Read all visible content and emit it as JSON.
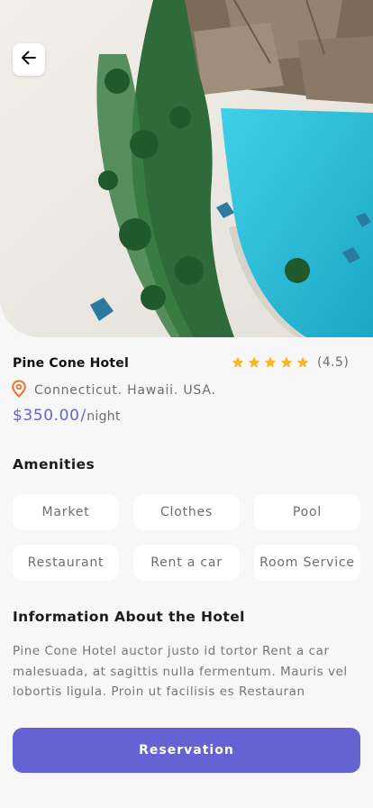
{
  "hotel": {
    "name": "Pine Cone Hotel",
    "rating_text": "(4.5)",
    "rating_value": 4.5,
    "stars_total": 5,
    "location": "Connecticut. Hawaii. USA.",
    "price": "$350.00",
    "price_separator": "/",
    "price_unit": "night"
  },
  "amenities": {
    "title": "Amenities",
    "items": [
      "Market",
      "Clothes",
      "Pool",
      "Restaurant",
      "Rent a car",
      "Room Service"
    ]
  },
  "info": {
    "title": "Information About the Hotel",
    "description": "Pine Cone Hotel auctor justo id tortor Rent a car malesuada, at sagittis nulla fermentum. Mauris vel lobortis ligula. Proin ut facilisis es Restauran"
  },
  "actions": {
    "reserve_label": "Reservation"
  },
  "icons": {
    "back": "arrow-left-icon",
    "location": "location-pin-icon",
    "star": "star-icon"
  },
  "colors": {
    "accent": "#6562d3",
    "star": "#f4b92b",
    "pin": "#e5742a",
    "background": "#f7f7f8"
  }
}
